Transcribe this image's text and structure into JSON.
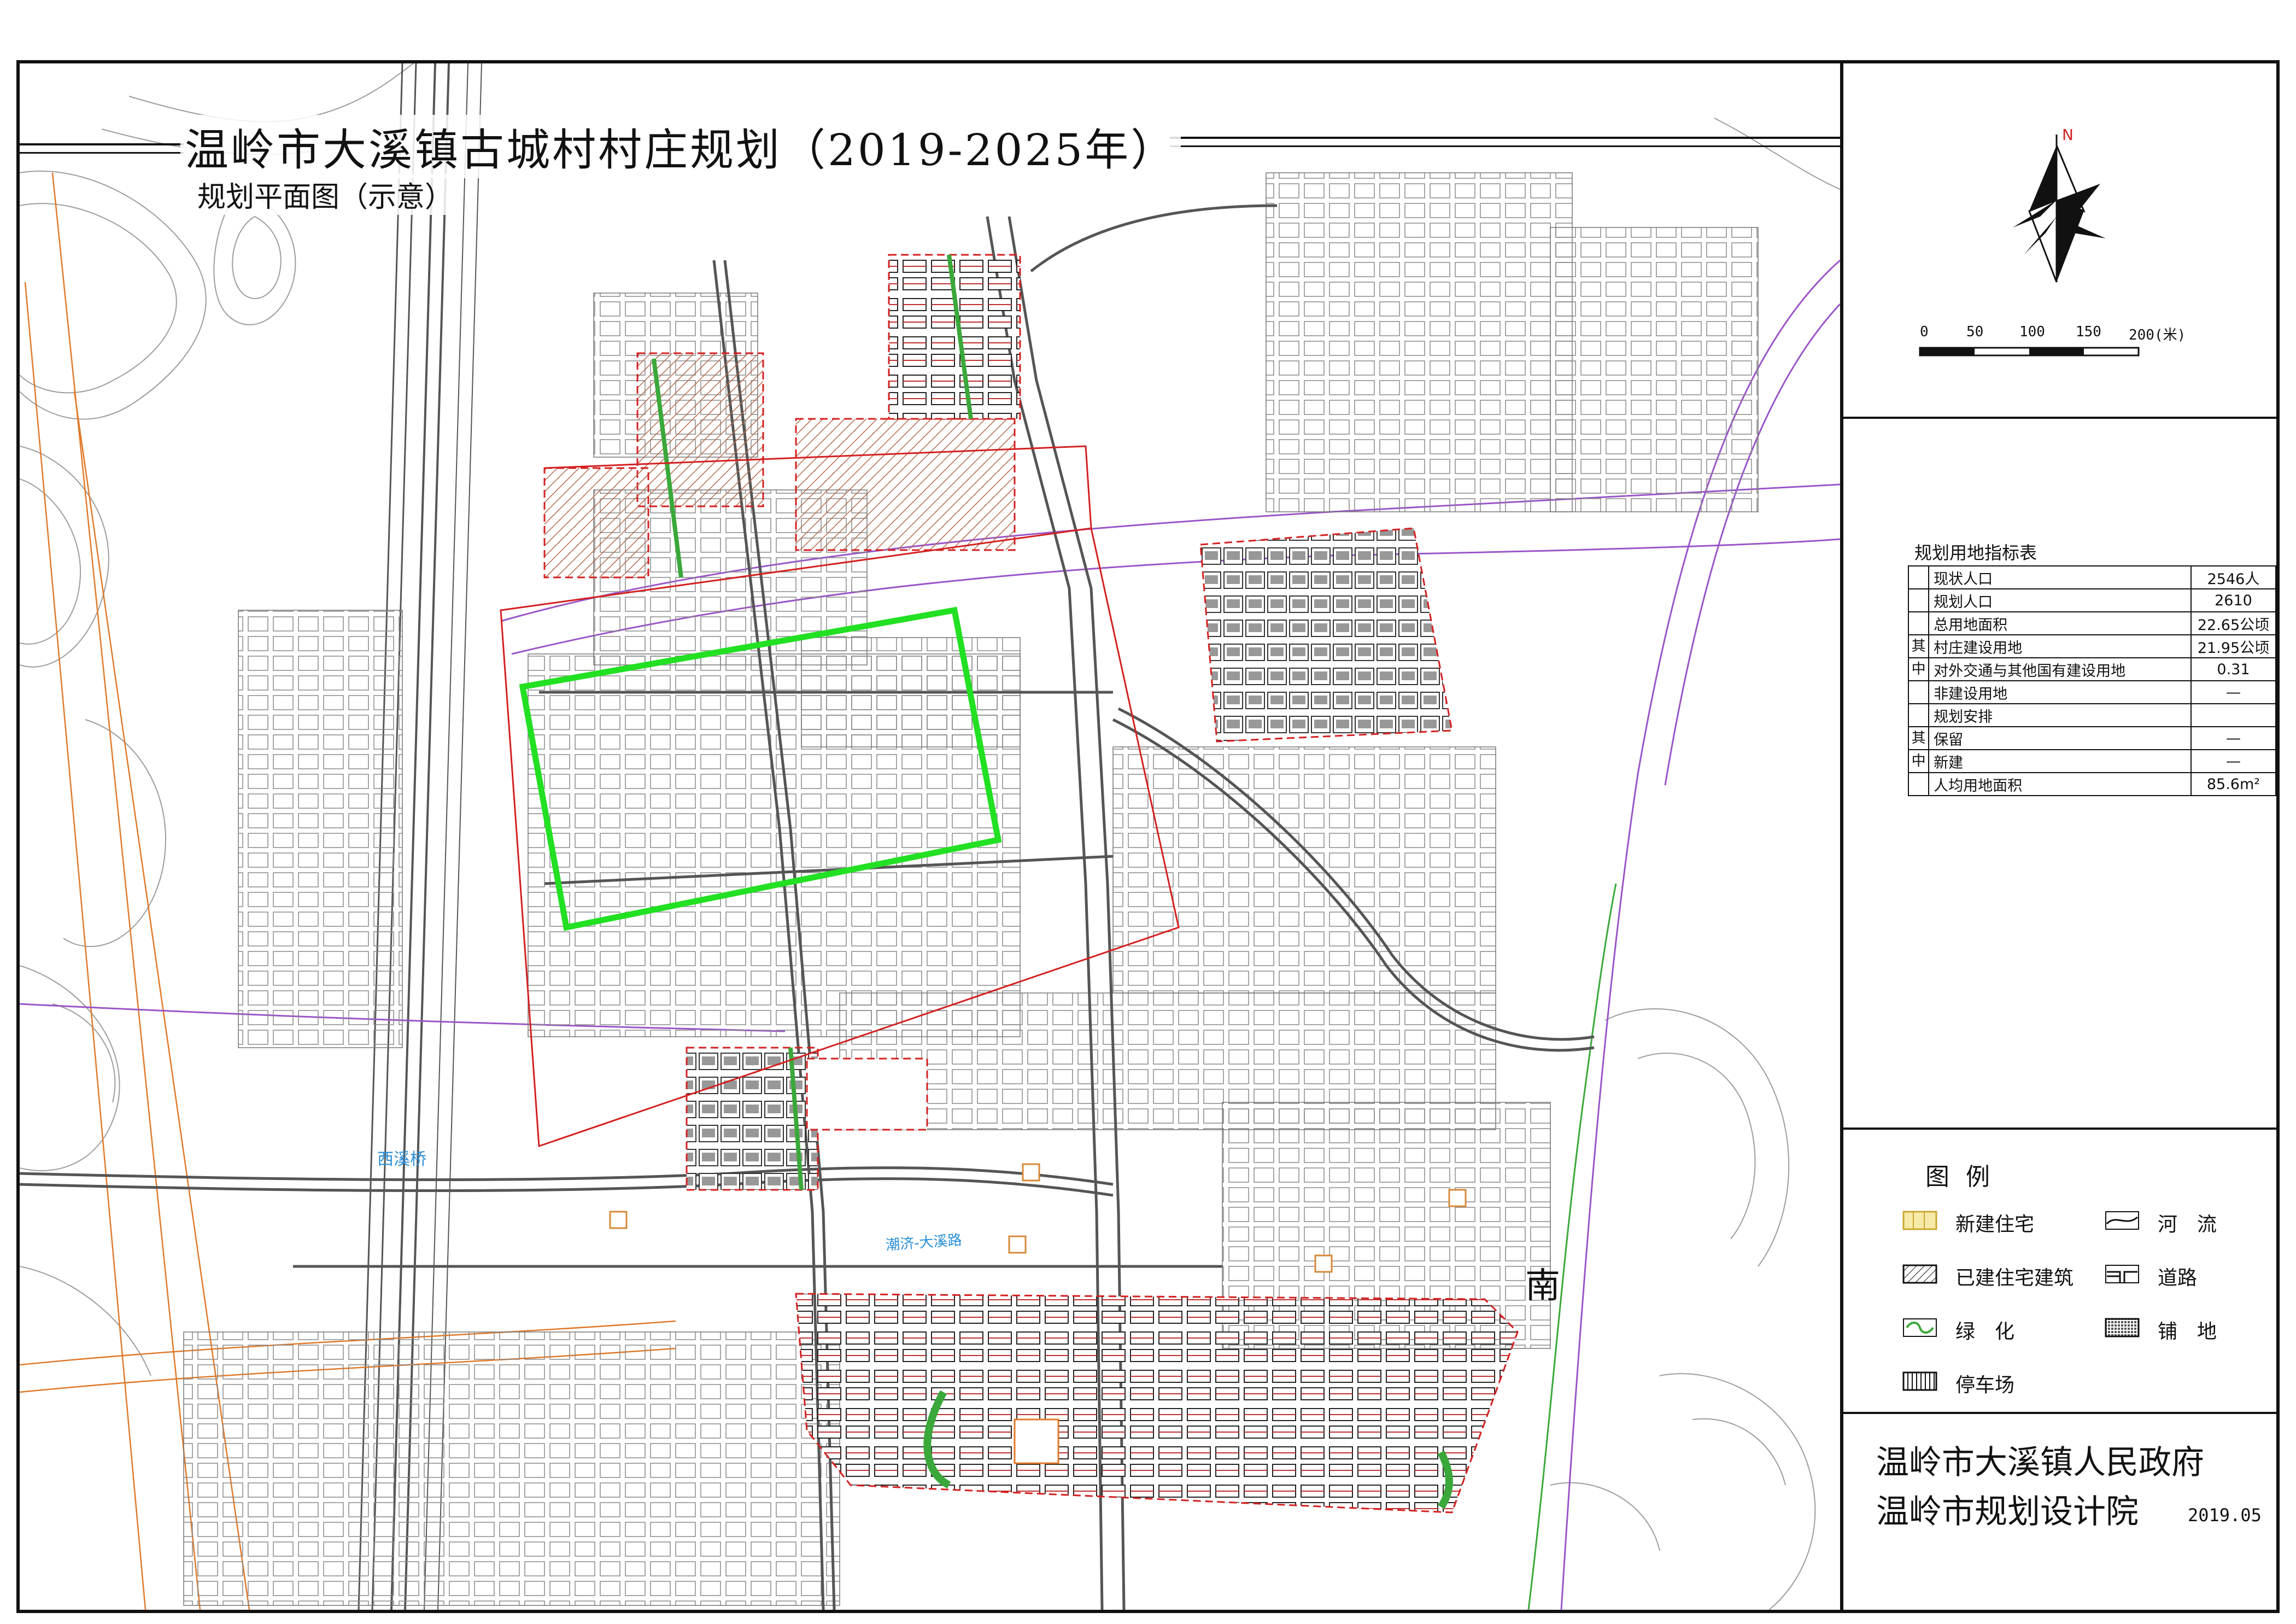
{
  "map": {
    "title": "温岭市大溪镇古城村村庄规划（2019-2025年）",
    "subtitle": "规划平面图（示意）",
    "south_label": "南",
    "river_label_1": "西溪桥",
    "river_label_2": "潮济-大溪路",
    "colors": {
      "boundary_red": "#d42020",
      "highlight_green": "#22e022",
      "road_gray": "#555555",
      "contour": "#999999",
      "purple_line": "#9a55c8",
      "orange_line": "#e07a2a",
      "green_line": "#3aa83a",
      "plot_fill": "#f1c7b0"
    }
  },
  "north_arrow": {
    "letter": "N"
  },
  "scale_bar": {
    "labels": [
      "0",
      "50",
      "100",
      "150",
      "200(米)"
    ]
  },
  "land_use_table": {
    "title": "规划用地指标表",
    "rows": [
      {
        "side": "",
        "name": "现状人口",
        "value": "2546人"
      },
      {
        "side": "",
        "name": "规划人口",
        "value": "2610"
      },
      {
        "side": "",
        "name": "总用地面积",
        "value": "22.65公顷"
      },
      {
        "side": "其",
        "name": "村庄建设用地",
        "value": "21.95公顷"
      },
      {
        "side": "中",
        "name": "对外交通与其他国有建设用地",
        "value": "0.31"
      },
      {
        "side": "",
        "name": "非建设用地",
        "value": "—"
      },
      {
        "side": "",
        "name": "规划安排",
        "value": ""
      },
      {
        "side": "其",
        "name": "保留",
        "value": "—"
      },
      {
        "side": "中",
        "name": "新建",
        "value": "—"
      },
      {
        "side": "",
        "name": "人均用地面积",
        "value": "85.6m²"
      }
    ]
  },
  "legend": {
    "title": "图例",
    "items": [
      {
        "label": "新建住宅",
        "symbol": "new-housing"
      },
      {
        "label": "河　流",
        "symbol": "river"
      },
      {
        "label": "已建住宅建筑",
        "symbol": "built-housing"
      },
      {
        "label": "道路",
        "symbol": "road"
      },
      {
        "label": "绿　化",
        "symbol": "greenery"
      },
      {
        "label": "铺　地",
        "symbol": "paving"
      },
      {
        "label": "停车场",
        "symbol": "parking"
      }
    ]
  },
  "organization": {
    "line1": "温岭市大溪镇人民政府",
    "line2": "温岭市规划设计院",
    "date": "2019.05"
  }
}
